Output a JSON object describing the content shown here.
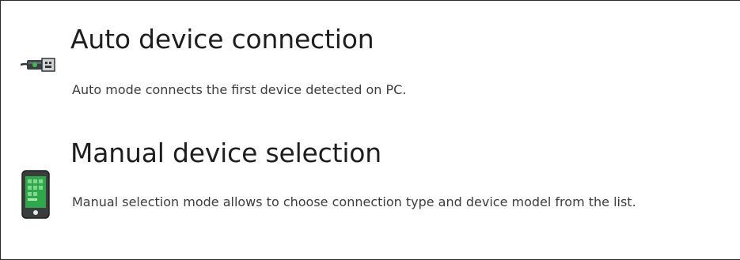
{
  "options": [
    {
      "title": "Auto device connection",
      "description": "Auto mode connects the first device detected on PC.",
      "icon": "usb-cable-icon"
    },
    {
      "title": "Manual device selection",
      "description": "Manual selection mode allows to choose connection type and device model from the list.",
      "icon": "smartphone-icon"
    }
  ],
  "colors": {
    "title": "#1e1e1e",
    "description": "#3c3c3c",
    "border": "#2b2b2b"
  }
}
